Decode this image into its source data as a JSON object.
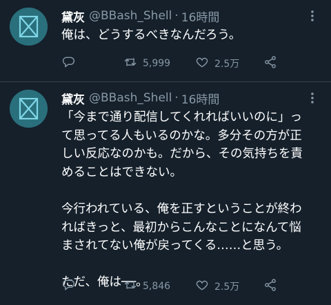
{
  "tweets": [
    {
      "name": "黛灰",
      "handle": "@BBash_Shell",
      "separator": "·",
      "time": "16時間",
      "lines": [
        "俺は、どうするべきなんだろう。"
      ],
      "retweets": "5,999",
      "likes": "2.5万"
    },
    {
      "name": "黛灰",
      "handle": "@BBash_Shell",
      "separator": "·",
      "time": "16時間",
      "lines": [
        "「今まで通り配信してくれればいいのに」っ",
        "て思ってる人もいるのかな。多分その方が正",
        "しい反応なのかも。だから、その気持ちを責",
        "めることはできない。",
        "",
        "今行われている、俺を正すということが終わ",
        "ればきっと、最初からこんなことになんて悩",
        "まされてない俺が戻ってくる……と思う。",
        "",
        "ただ、俺は──。"
      ],
      "retweets": "5,846",
      "likes": "2.5万"
    }
  ],
  "icons": [
    "reply-icon",
    "retweet-icon",
    "like-icon",
    "share-icon",
    "more-icon"
  ],
  "colors": {
    "background": "#15202b",
    "secondary_text": "#8899a6",
    "divider": "#38444d",
    "avatar": "#2a6f7c"
  }
}
